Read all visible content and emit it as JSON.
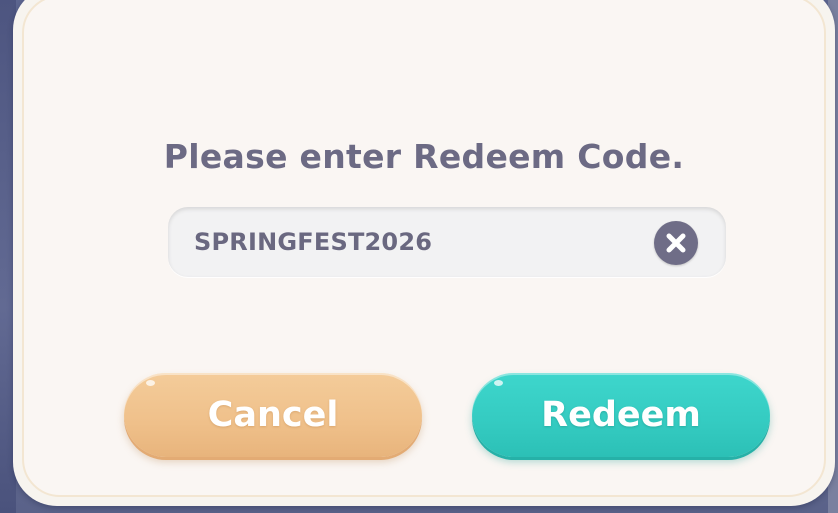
{
  "dialog": {
    "prompt": "Please enter Redeem Code.",
    "code_field": {
      "value": "SPRINGFEST2026",
      "clear_icon": "close-circle-icon"
    },
    "buttons": {
      "cancel_label": "Cancel",
      "redeem_label": "Redeem"
    }
  },
  "colors": {
    "dialog_background": "#faf6f3",
    "dialog_border": "#f3e6d2",
    "text": "#6c6a84",
    "cancel_button": "#efc08a",
    "redeem_button": "#34cbc1",
    "backdrop": "#5d6690"
  }
}
